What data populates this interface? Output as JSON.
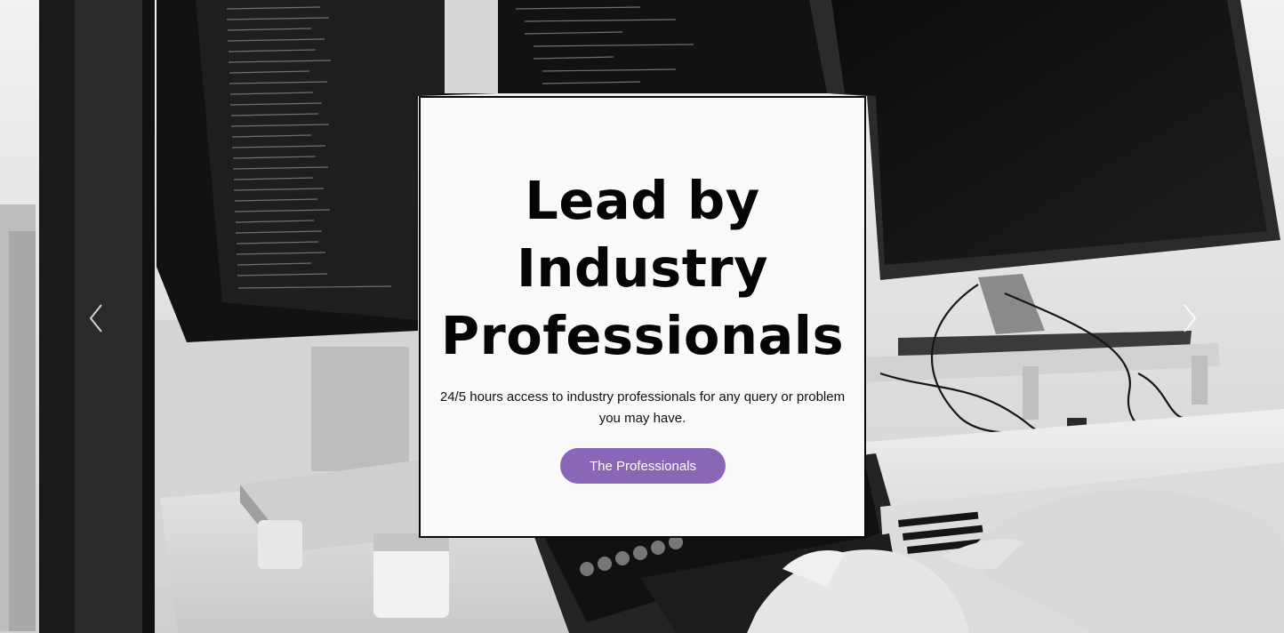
{
  "hero": {
    "headline_lines": [
      "Lead by",
      "Industry",
      "Professionals"
    ],
    "subtext": "24/5 hours access to industry professionals for any query or problem you may have.",
    "cta_label": "The Professionals",
    "accent_color": "#8a66b6",
    "background_image": "black-and-white photo of a workspace with two monitors showing code and hands typing on a laptop",
    "prev_icon": "chevron-left-icon",
    "next_icon": "chevron-right-icon"
  }
}
